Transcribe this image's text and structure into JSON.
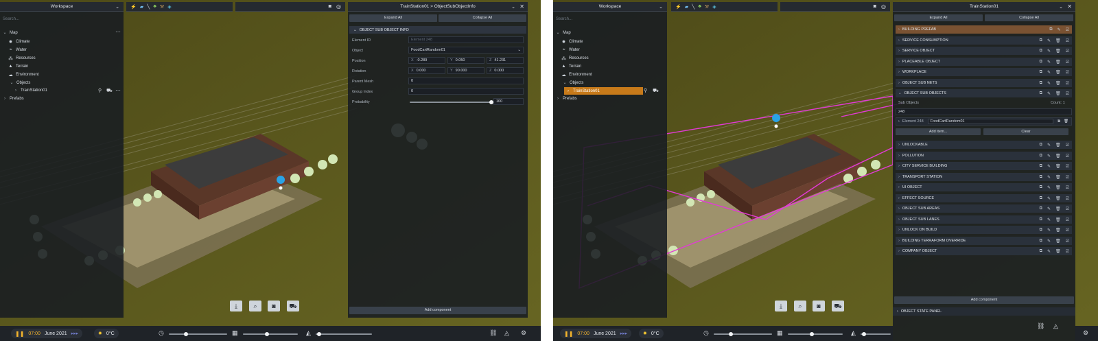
{
  "left": {
    "workspace_title": "Workspace",
    "search_placeholder": "Search...",
    "tree": [
      {
        "label": "Map",
        "icon": "chevron-down-icon"
      },
      {
        "label": "Climate",
        "icon": "sun-icon"
      },
      {
        "label": "Water",
        "icon": "water-icon"
      },
      {
        "label": "Resources",
        "icon": "resources-icon"
      },
      {
        "label": "Terrain",
        "icon": "terrain-icon"
      },
      {
        "label": "Environment",
        "icon": "cloud-icon"
      },
      {
        "label": "Objects",
        "icon": "chevron-down-icon"
      },
      {
        "label": "TrainStation01",
        "icon": "chevron-right-icon"
      },
      {
        "label": "Prefabs",
        "icon": "chevron-right-icon"
      }
    ],
    "inspector": {
      "title": "TrainStation01 > ObjectSubObjectInfo",
      "expand_all": "Expand All",
      "collapse_all": "Collapse All",
      "section": "OBJECT SUB OBJECT INFO",
      "element_id_label": "Element ID",
      "element_id_placeholder": "Element 248",
      "object_label": "Object",
      "object_value": "FoodCartRandom01",
      "position_label": "Position",
      "position": {
        "x": "-0.289",
        "y": "0.050",
        "z": "41.231"
      },
      "rotation_label": "Rotation",
      "rotation": {
        "x": "0.000",
        "y": "90.000",
        "z": "0.000"
      },
      "parent_mesh_label": "Parent Mesh",
      "parent_mesh_value": "0",
      "group_index_label": "Group Index",
      "group_index_value": "0",
      "probability_label": "Probability",
      "probability_value": "100",
      "add_component": "Add component"
    },
    "bottom": {
      "time": "07:00",
      "date": "June 2021",
      "temperature": "0°C"
    }
  },
  "right": {
    "workspace_title": "Workspace",
    "search_placeholder": "Search...",
    "tree": [
      {
        "label": "Map"
      },
      {
        "label": "Climate"
      },
      {
        "label": "Water"
      },
      {
        "label": "Resources"
      },
      {
        "label": "Terrain"
      },
      {
        "label": "Environment"
      },
      {
        "label": "Objects"
      },
      {
        "label": "TrainStation01"
      },
      {
        "label": "Prefabs"
      }
    ],
    "inspector": {
      "title": "TrainStation01",
      "expand_all": "Expand All",
      "collapse_all": "Collapse All",
      "components_top": [
        "BUILDING PREFAB",
        "SERVICE CONSUMPTION",
        "SERVICE OBJECT",
        "PLACEABLE OBJECT",
        "WORKPLACE",
        "OBJECT SUB NETS",
        "OBJECT SUB OBJECTS"
      ],
      "sub_objects_label": "Sub Objects",
      "sub_objects_count": "Count: 1",
      "sub_objects_value": "248",
      "element_label": "Element 248",
      "element_value": "FoodCartRandom01",
      "add_item": "Add item...",
      "clear": "Clear",
      "components_bottom": [
        "UNLOCKABLE",
        "POLLUTION",
        "CITY SERVICE BUILDING",
        "TRANSPORT STATION",
        "UI OBJECT",
        "EFFECT SOURCE",
        "OBJECT SUB AREAS",
        "OBJECT SUB LANES",
        "UNLOCK ON BUILD",
        "BUILDING TERRAFORM OVERRIDE",
        "COMPANY OBJECT"
      ],
      "add_component": "Add component",
      "state_panel": "OBJECT STATE PANEL"
    },
    "bottom": {
      "time": "07:00",
      "date": "June 2021",
      "temperature": "0°C"
    }
  },
  "colors": {
    "accent_orange": "#c77a1a",
    "selection_magenta": "#e23ad6",
    "panel_bg": "#181c22",
    "header_bg": "#252a30",
    "terrain": "#5f5c1e"
  }
}
